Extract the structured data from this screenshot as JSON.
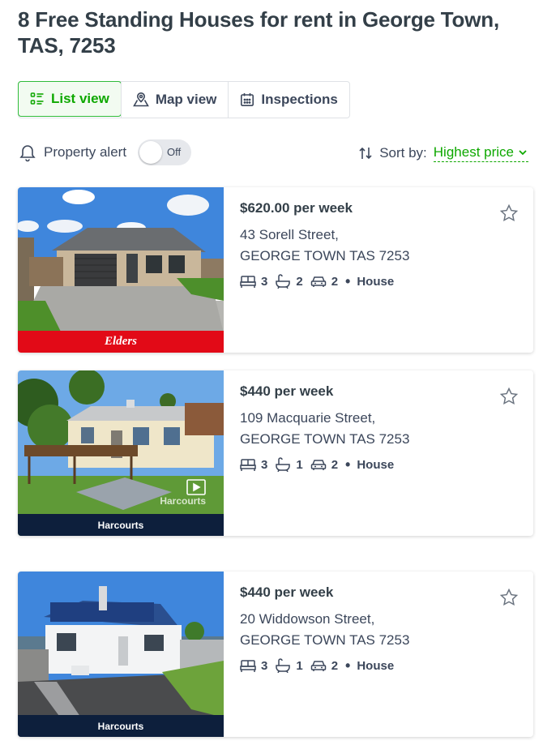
{
  "page_title": "8 Free Standing Houses for rent in George Town, TAS, 7253",
  "view_tabs": [
    {
      "label": "List view",
      "icon": "list-icon",
      "active": true
    },
    {
      "label": "Map view",
      "icon": "map-pin-icon",
      "active": false
    },
    {
      "label": "Inspections",
      "icon": "calendar-icon",
      "active": false
    }
  ],
  "property_alert": {
    "label": "Property alert",
    "toggle_state": "Off"
  },
  "sort": {
    "label": "Sort by:",
    "value": "Highest price"
  },
  "colors": {
    "accent": "#0ea800",
    "text": "#3c475b",
    "elders_red": "#e20a17",
    "harcourts_navy": "#0d1f3c"
  },
  "listings": [
    {
      "price": "$620.00 per week",
      "address_line1": "43 Sorell Street,",
      "address_line2": "GEORGE TOWN TAS 7253",
      "beds": "3",
      "baths": "2",
      "cars": "2",
      "property_type": "House",
      "agency": "Elders"
    },
    {
      "price": "$440 per week",
      "address_line1": "109 Macquarie Street,",
      "address_line2": "GEORGE TOWN TAS 7253",
      "beds": "3",
      "baths": "1",
      "cars": "2",
      "property_type": "House",
      "agency": "Harcourts",
      "watermark": "Harcourts"
    },
    {
      "price": "$440 per week",
      "address_line1": "20 Widdowson Street,",
      "address_line2": "GEORGE TOWN TAS 7253",
      "beds": "3",
      "baths": "1",
      "cars": "2",
      "property_type": "House",
      "agency": "Harcourts"
    }
  ]
}
